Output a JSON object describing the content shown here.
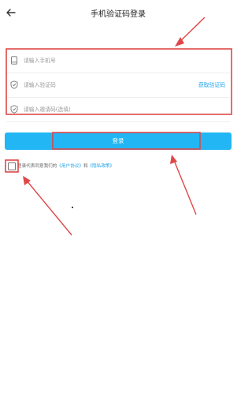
{
  "header": {
    "title": "手机验证码登录",
    "back_icon": "arrow-left-icon"
  },
  "form": {
    "phone": {
      "icon": "phone-icon",
      "placeholder": "请输入手机号",
      "value": ""
    },
    "code": {
      "icon": "shield-check-icon",
      "placeholder": "请输入验证码",
      "value": "",
      "get_code_label": "获取验证码"
    },
    "invite": {
      "icon": "shield-check-icon",
      "placeholder": "请输入邀请码(选填)",
      "value": ""
    }
  },
  "login_button": {
    "label": "登录"
  },
  "agreement": {
    "checked": false,
    "prefix": "登录代表同意我们的",
    "user_agreement": "《用户协议》",
    "joiner": "和",
    "privacy_policy": "《隐私政策》"
  },
  "colors": {
    "accent": "#22b6f4",
    "link": "#1fa3ea",
    "annotation": "#e04747"
  }
}
